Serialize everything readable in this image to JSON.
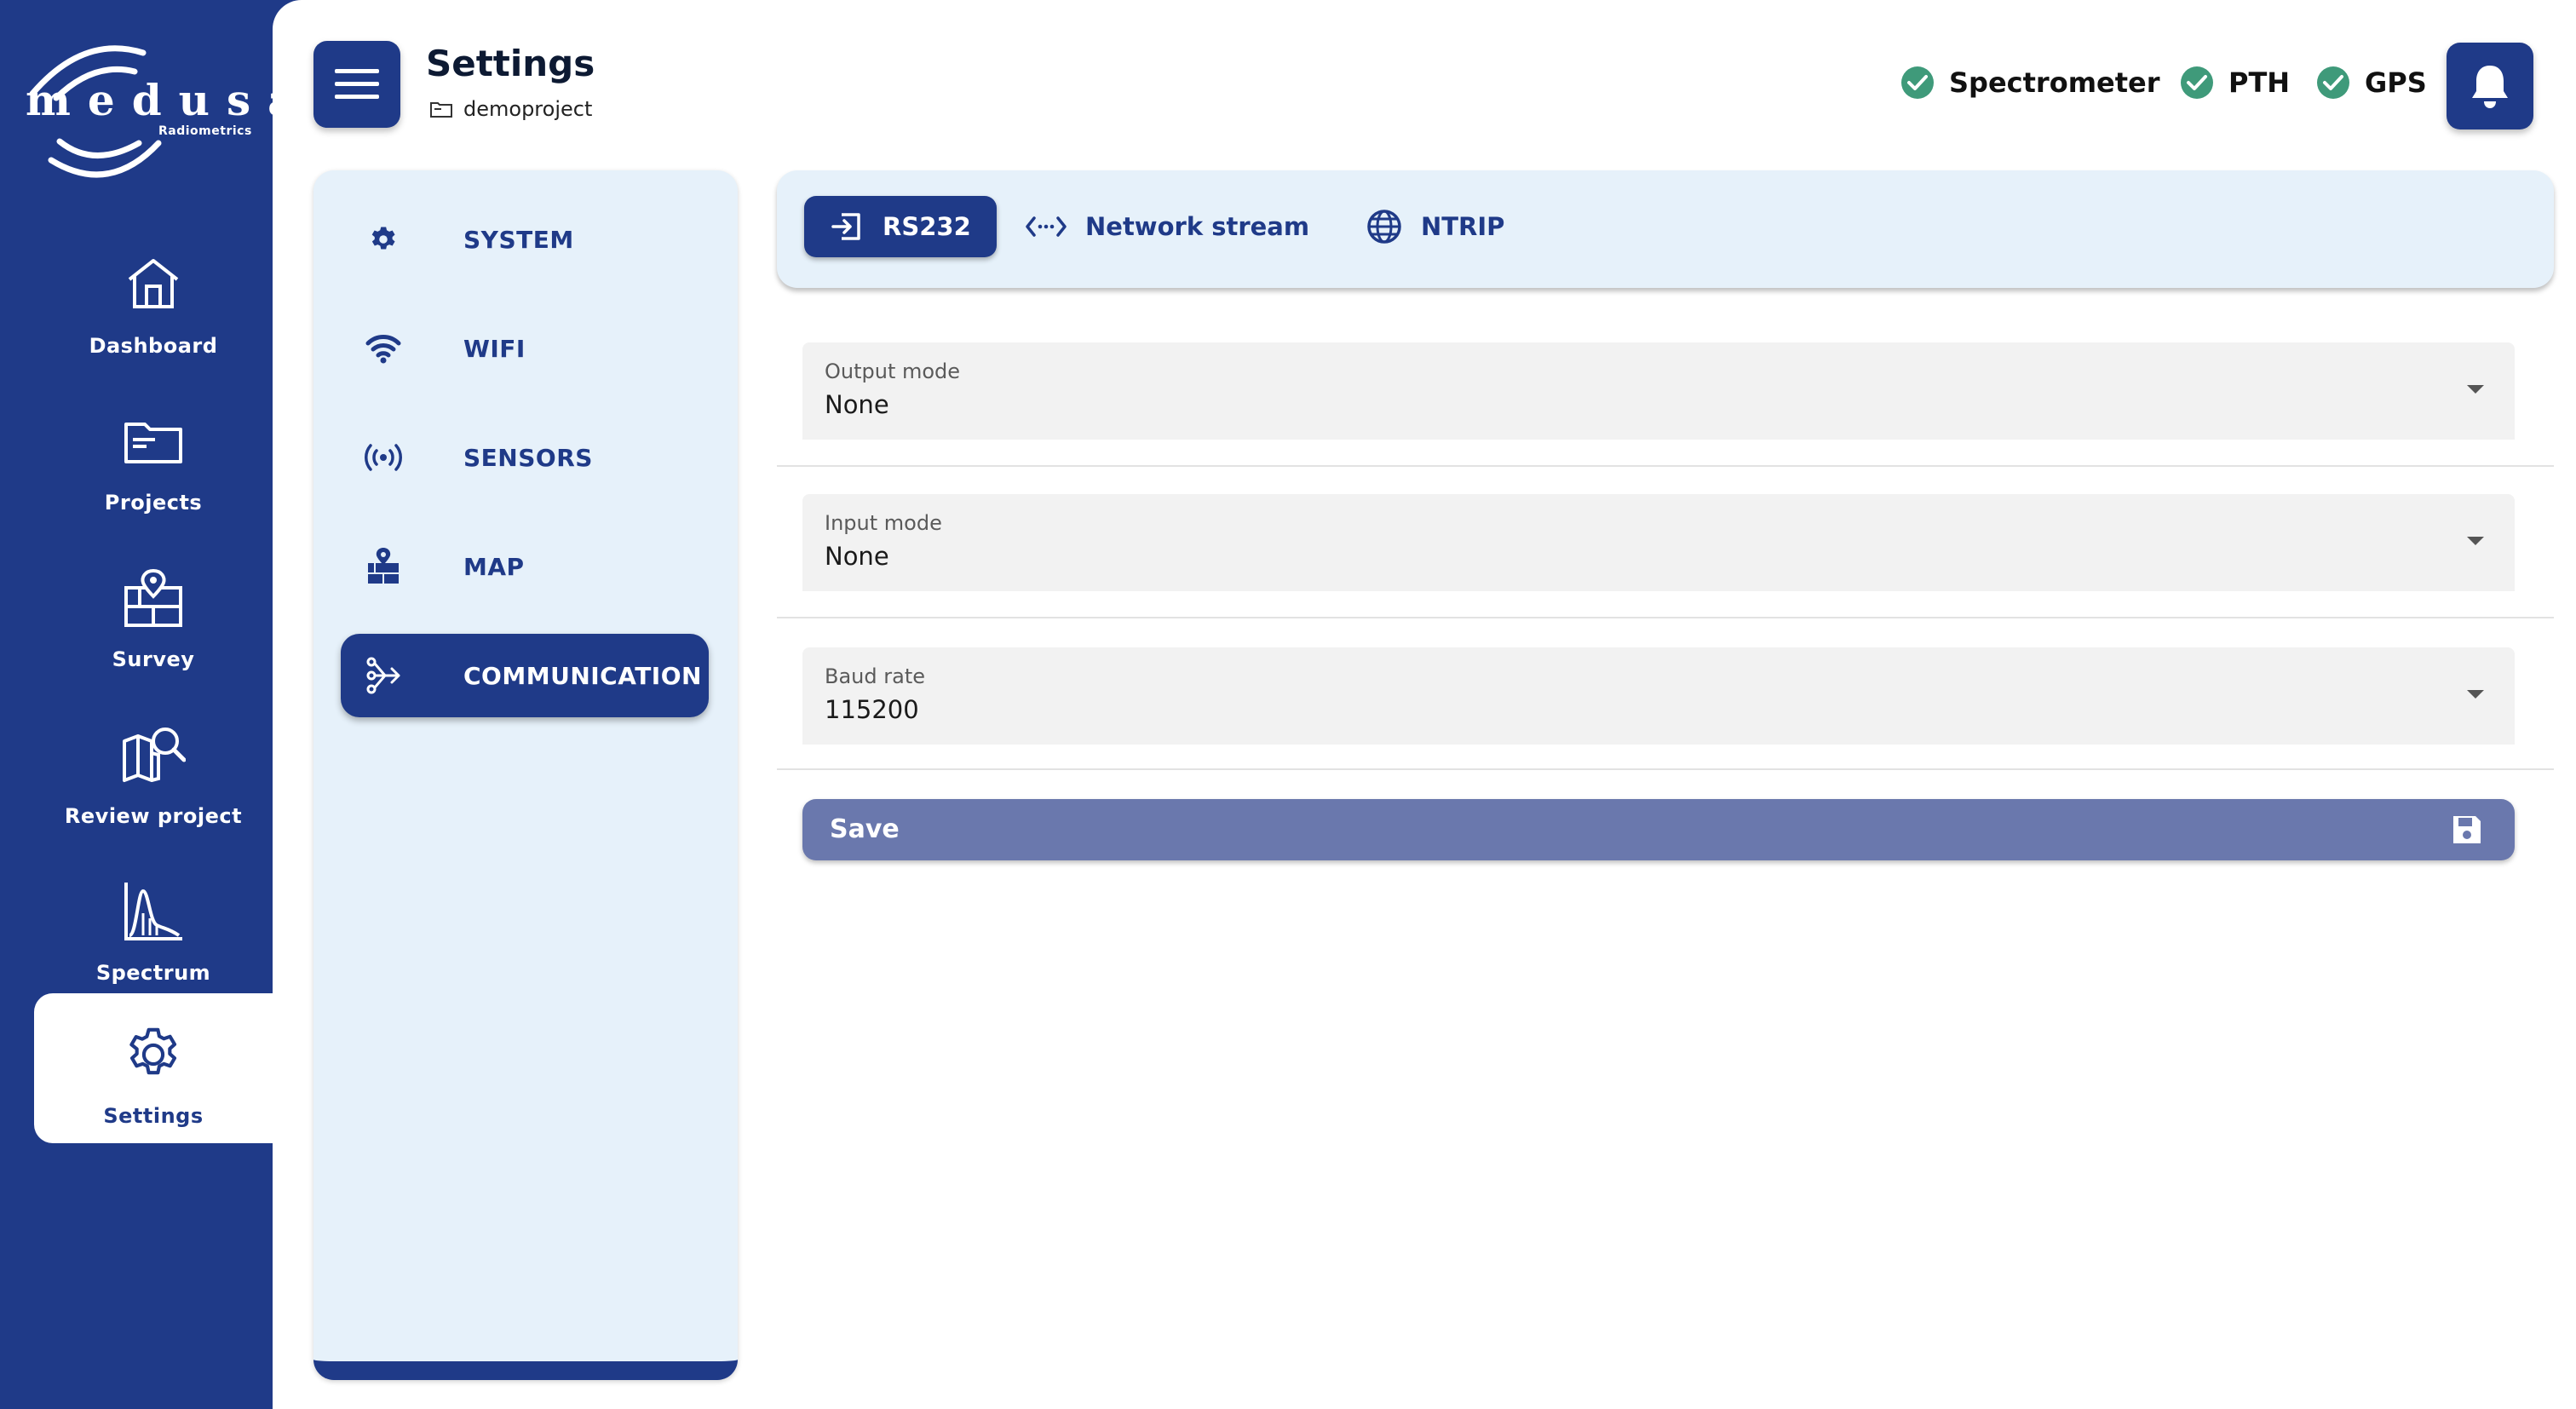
{
  "brand": {
    "name": "medusa",
    "sub": "Radiometrics"
  },
  "nav": {
    "items": [
      {
        "label": "Dashboard",
        "icon": "home-icon"
      },
      {
        "label": "Projects",
        "icon": "folder-icon"
      },
      {
        "label": "Survey",
        "icon": "survey-map-icon"
      },
      {
        "label": "Review project",
        "icon": "map-search-icon"
      },
      {
        "label": "Spectrum",
        "icon": "spectrum-chart-icon"
      },
      {
        "label": "Settings",
        "icon": "gear-icon",
        "active": true
      }
    ]
  },
  "header": {
    "title": "Settings",
    "project": "demoproject",
    "status": [
      {
        "label": "Spectrometer",
        "state": "ok"
      },
      {
        "label": "PTH",
        "state": "ok"
      },
      {
        "label": "GPS",
        "state": "ok"
      }
    ]
  },
  "settings_menu": {
    "items": [
      {
        "label": "SYSTEM",
        "icon": "gear-icon"
      },
      {
        "label": "WIFI",
        "icon": "wifi-icon"
      },
      {
        "label": "SENSORS",
        "icon": "sensor-signal-icon"
      },
      {
        "label": "MAP",
        "icon": "map-icon"
      },
      {
        "label": "COMMUNICATION",
        "icon": "communication-icon",
        "active": true
      }
    ]
  },
  "tabs": [
    {
      "label": "RS232",
      "icon": "input-icon",
      "active": true
    },
    {
      "label": "Network stream",
      "icon": "code-arrows-icon"
    },
    {
      "label": "NTRIP",
      "icon": "globe-icon"
    }
  ],
  "form": {
    "output_mode": {
      "label": "Output mode",
      "value": "None"
    },
    "input_mode": {
      "label": "Input mode",
      "value": "None"
    },
    "baud_rate": {
      "label": "Baud rate",
      "value": "115200"
    },
    "save_label": "Save"
  },
  "colors": {
    "primary": "#1f3a88",
    "panel_bg": "#e6f1fa",
    "ok_green": "#3f9a7a",
    "save_bg": "#6a78ad",
    "field_bg": "#f2f2f2"
  }
}
